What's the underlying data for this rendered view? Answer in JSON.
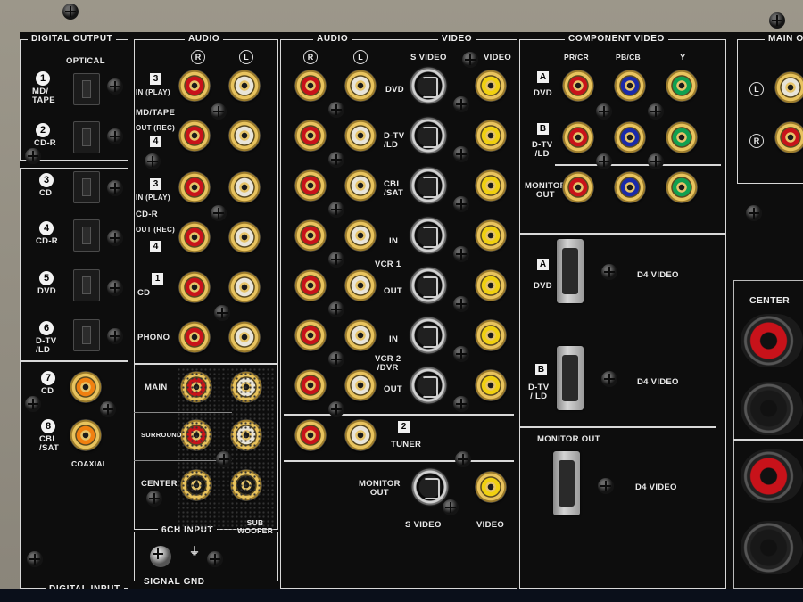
{
  "digital_output": {
    "header": "DIGITAL OUTPUT",
    "optical_label": "OPTICAL",
    "ports": [
      {
        "num": "1",
        "label": "MD/\nTAPE"
      },
      {
        "num": "2",
        "label": "CD-R"
      }
    ]
  },
  "digital_input": {
    "header": "DIGITAL INPUT",
    "optical_ports": [
      {
        "num": "3",
        "label": "CD"
      },
      {
        "num": "4",
        "label": "CD-R"
      },
      {
        "num": "5",
        "label": "DVD"
      },
      {
        "num": "6",
        "label": "D-TV\n/LD"
      }
    ],
    "coax_ports": [
      {
        "num": "7",
        "label": "CD"
      },
      {
        "num": "8",
        "label": "CBL\n/SAT"
      }
    ],
    "coaxial_label": "COAXIAL"
  },
  "audio_left": {
    "header": "AUDIO",
    "channel_r": "R",
    "channel_l": "L",
    "rows": [
      {
        "box": "3",
        "label": "IN (PLAY)"
      },
      {
        "group": "MD/TAPE"
      },
      {
        "label": "OUT (REC)",
        "box": "4"
      },
      {
        "box": "3",
        "label": "IN (PLAY)"
      },
      {
        "group": "CD-R"
      },
      {
        "label": "OUT (REC)",
        "box": "4"
      },
      {
        "box": "1",
        "label": "CD"
      },
      {
        "label": "PHONO"
      }
    ]
  },
  "six_ch_input": {
    "header": "6CH INPUT",
    "main": "MAIN",
    "surround": "SURROUND",
    "center": "CENTER",
    "subwoofer": "SUB\nWOOFER"
  },
  "signal_gnd": "SIGNAL GND",
  "audio_video": {
    "audio_header": "AUDIO",
    "video_header": "VIDEO",
    "channel_r": "R",
    "channel_l": "L",
    "s_video": "S VIDEO",
    "video": "VIDEO",
    "rows": [
      "DVD",
      "D-TV\n/LD",
      "CBL\n/SAT",
      "IN",
      "OUT",
      "IN",
      "OUT"
    ],
    "vcr1": "VCR 1",
    "vcr2": "VCR 2\n/DVR",
    "tuner_box": "2",
    "tuner": "TUNER",
    "monitor_out": "MONITOR\nOUT",
    "s_video_bottom": "S VIDEO",
    "video_bottom": "VIDEO"
  },
  "component_video": {
    "header": "COMPONENT VIDEO",
    "col_pr": "PR/CR",
    "col_pb": "PB/CB",
    "col_y": "Y",
    "rows": [
      {
        "box": "A",
        "label": "DVD"
      },
      {
        "box": "B",
        "label": "D-TV\n/LD"
      },
      {
        "label": "MONITOR\nOUT"
      }
    ]
  },
  "d4_video": {
    "rows": [
      {
        "box": "A",
        "label": "DVD",
        "name": "D4 VIDEO"
      },
      {
        "box": "B",
        "label": "D-TV\n/ LD",
        "name": "D4 VIDEO"
      },
      {
        "label": "MONITOR OUT",
        "name": "D4 VIDEO"
      }
    ]
  },
  "main_out": {
    "header": "MAIN O",
    "channel_l": "L",
    "channel_r": "R"
  },
  "center_speaker": "CENTER",
  "colors": {
    "red": "#c8121a",
    "white": "#e8e4d8",
    "yellow": "#f0d010",
    "blue": "#1a2aa8",
    "green": "#10a050",
    "orange": "#f08010",
    "black": "#141414"
  }
}
